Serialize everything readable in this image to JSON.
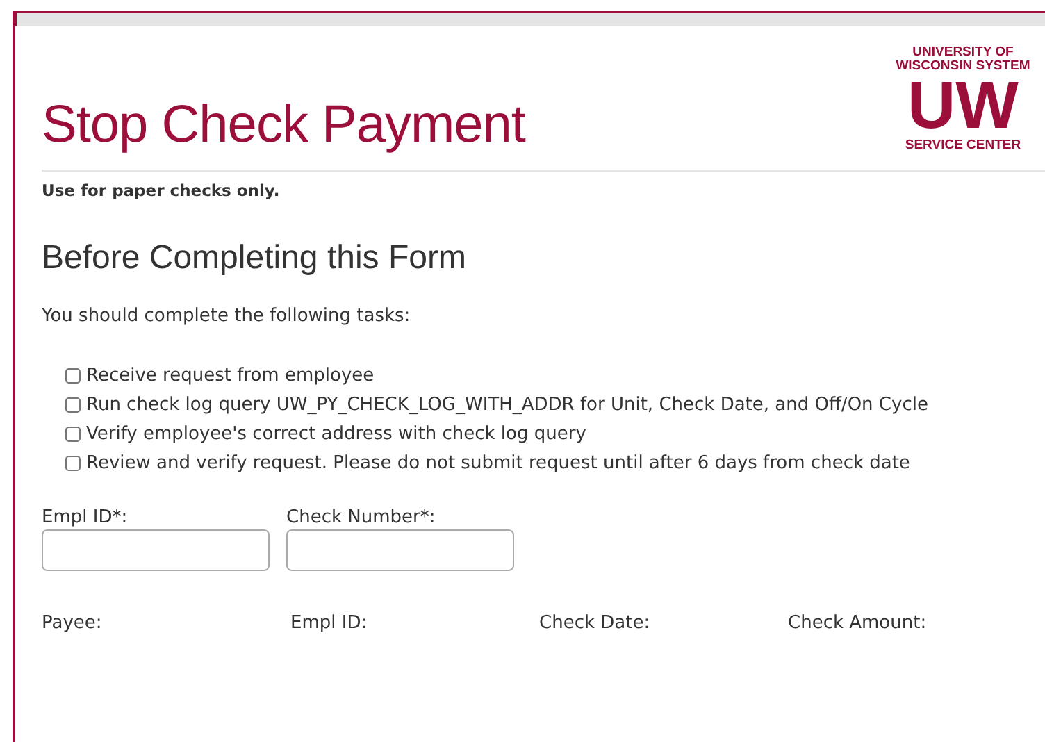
{
  "title": "Stop Check Payment",
  "logo": {
    "line_1": "UNIVERSITY OF",
    "line_2": "WISCONSIN SYSTEM",
    "mark": "UW",
    "line_3": "SERVICE CENTER"
  },
  "note": "Use for paper checks only.",
  "section": {
    "heading": "Before Completing this Form",
    "intro": "You should complete the following tasks:"
  },
  "tasks": [
    {
      "label": "Receive request from employee",
      "checked": false
    },
    {
      "label": "Run check log query UW_PY_CHECK_LOG_WITH_ADDR for Unit, Check Date, and Off/On Cycle",
      "checked": false
    },
    {
      "label": "Verify employee's correct address with check log query",
      "checked": false
    },
    {
      "label": "Review and verify request. Please do not submit request until after 6 days from check date",
      "checked": false
    }
  ],
  "fields": [
    {
      "label": "Empl ID*:"
    },
    {
      "label": "Check Number*:"
    }
  ],
  "info_labels": [
    "Payee:",
    "Empl ID:",
    "Check Date:",
    "Check Amount:"
  ]
}
